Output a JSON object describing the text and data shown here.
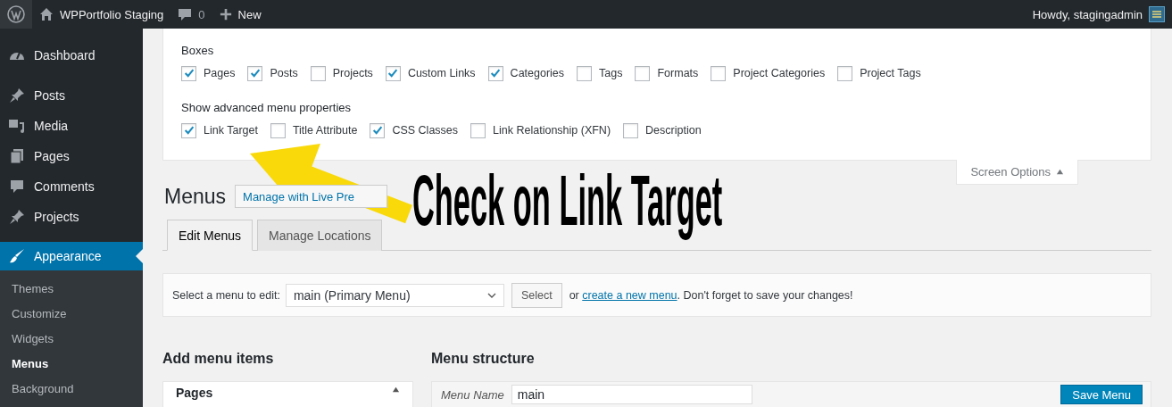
{
  "admin_bar": {
    "site_name": "WPPortfolio Staging",
    "comments_count": "0",
    "new_label": "New",
    "greeting": "Howdy, stagingadmin"
  },
  "sidebar": {
    "items": [
      {
        "label": "Dashboard",
        "selected": false
      },
      {
        "label": "Posts",
        "selected": false
      },
      {
        "label": "Media",
        "selected": false
      },
      {
        "label": "Pages",
        "selected": false
      },
      {
        "label": "Comments",
        "selected": false
      },
      {
        "label": "Projects",
        "selected": false
      },
      {
        "label": "Appearance",
        "selected": true
      }
    ],
    "submenu": [
      {
        "label": "Themes",
        "selected": false
      },
      {
        "label": "Customize",
        "selected": false
      },
      {
        "label": "Widgets",
        "selected": false
      },
      {
        "label": "Menus",
        "selected": true
      },
      {
        "label": "Background",
        "selected": false
      }
    ]
  },
  "screen_options": {
    "boxes_heading": "Boxes",
    "boxes": [
      {
        "label": "Pages",
        "checked": true
      },
      {
        "label": "Posts",
        "checked": true
      },
      {
        "label": "Projects",
        "checked": false
      },
      {
        "label": "Custom Links",
        "checked": true
      },
      {
        "label": "Categories",
        "checked": true
      },
      {
        "label": "Tags",
        "checked": false
      },
      {
        "label": "Formats",
        "checked": false
      },
      {
        "label": "Project Categories",
        "checked": false
      },
      {
        "label": "Project Tags",
        "checked": false
      }
    ],
    "advanced_heading": "Show advanced menu properties",
    "advanced": [
      {
        "label": "Link Target",
        "checked": true
      },
      {
        "label": "Title Attribute",
        "checked": false
      },
      {
        "label": "CSS Classes",
        "checked": true
      },
      {
        "label": "Link Relationship (XFN)",
        "checked": false
      },
      {
        "label": "Description",
        "checked": false
      }
    ],
    "toggle_label": "Screen Options"
  },
  "page": {
    "title": "Menus",
    "live_preview": "Manage with Live Pre",
    "tabs": [
      {
        "label": "Edit Menus",
        "selected": true
      },
      {
        "label": "Manage Locations",
        "selected": false
      }
    ],
    "select_bar": {
      "label": "Select a menu to edit:",
      "value": "main (Primary Menu)",
      "button": "Select",
      "prefix": "or",
      "link": "create a new menu",
      "suffix": ". Don't forget to save your changes!"
    },
    "add_items_heading": "Add menu items",
    "pages_section": "Pages",
    "structure_heading": "Menu structure",
    "menu_name_label": "Menu Name",
    "menu_name_value": "main",
    "save_button": "Save Menu"
  },
  "annotation": {
    "text": "Check on Link Target"
  }
}
